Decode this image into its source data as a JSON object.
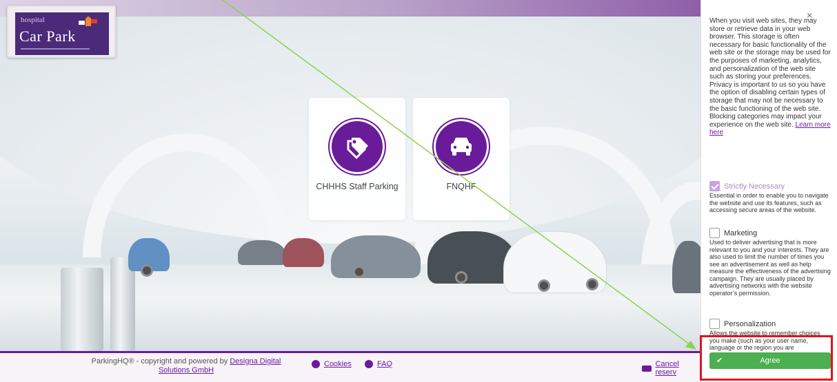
{
  "logo": {
    "small_text": "hospital",
    "main_text": "Car Park"
  },
  "tiles": [
    {
      "label": "CHHHS Staff Parking",
      "icon": "tag-icon"
    },
    {
      "label": "FNQHF",
      "icon": "car-icon"
    }
  ],
  "footer": {
    "copyright_prefix": "ParkingHQ® - copyright and powered by",
    "copyright_link": "Designa Digital Solutions GmbH",
    "cookies": "Cookies",
    "faq": "FAQ",
    "cancel": "Cancel reserv"
  },
  "consent": {
    "close_glyph": "×",
    "intro": "When you visit web sites, they may store or retrieve data in your web browser. This storage is often necessary for basic functionality of the web site or the storage may be used for the purposes of marketing, analytics, and personalization of the web site such as storing your preferences. Privacy is important to us so you have the option of disabling certain types of storage that may not be necessary to the basic functioning of the web site. Blocking categories may impact your experience on the web site.",
    "learn_more": "Learn more here",
    "categories": [
      {
        "title": "Strictly Necessary",
        "checked": true,
        "description": "Essential in order to enable you to navigate the website and use its features, such as accessing secure areas of the website."
      },
      {
        "title": "Marketing",
        "checked": false,
        "description": "Used to deliver advertising that is more relevant to you and your interests. They are also used to limit the number of times you see an advertisement as well as help measure the effectiveness of the advertising campaign. They are usually placed by advertising networks with the website operator’s permission."
      },
      {
        "title": "Personalization",
        "checked": false,
        "description": "Allows the website to remember choices you make (such as your user name, language or the region you are"
      }
    ],
    "agree": "Agree"
  },
  "colors": {
    "brand_purple": "#6a1b9a",
    "agree_green": "#4caf50",
    "highlight_red": "#e0141a",
    "arrow_green": "#8fd14f"
  }
}
